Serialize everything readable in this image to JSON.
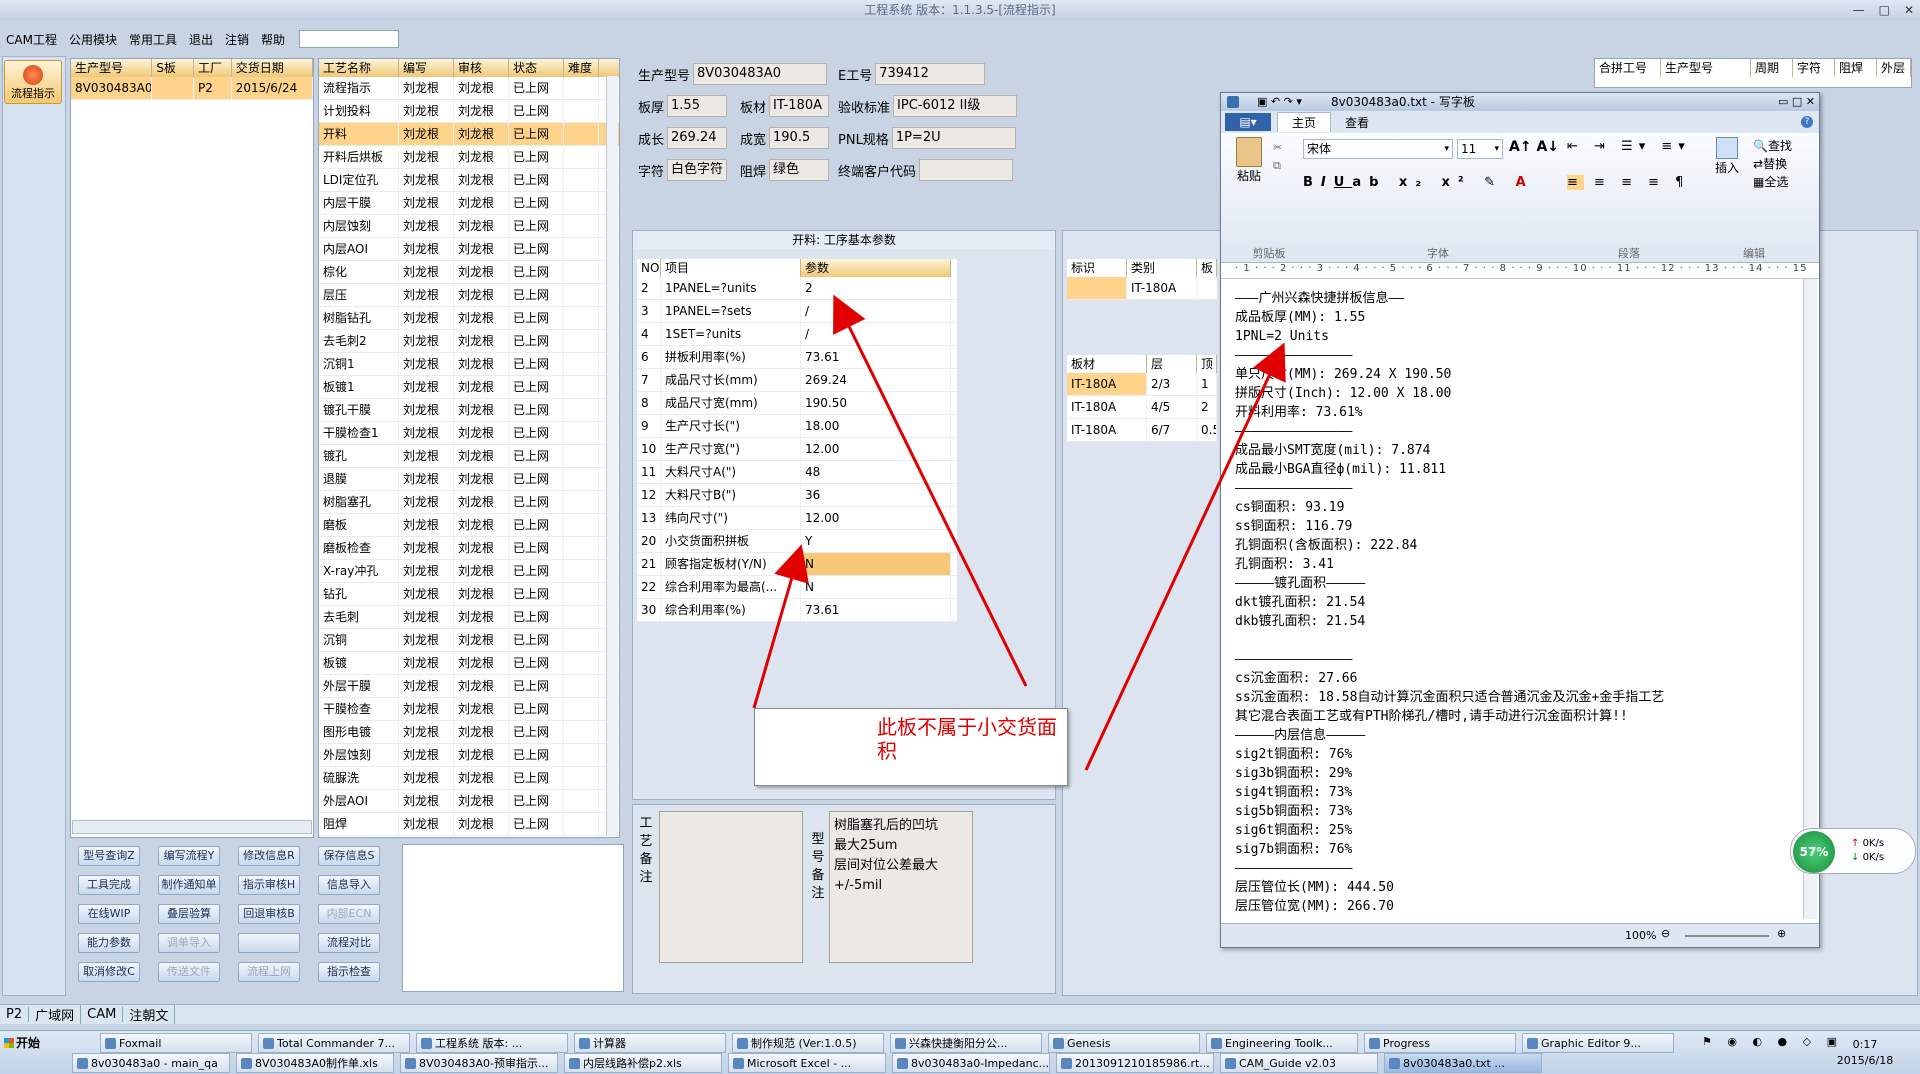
{
  "app": {
    "title": "工程系统 版本：1.1.3.5-[流程指示]",
    "controls": [
      "—",
      "□",
      "✕"
    ]
  },
  "menu": [
    "CAM工程",
    "公用模块",
    "常用工具",
    "退出",
    "注销",
    "帮助"
  ],
  "leftnav": {
    "label": "流程指示"
  },
  "orders": {
    "headers": [
      "生产型号",
      "S板",
      "工厂",
      "交货日期"
    ],
    "rows": [
      [
        "8V030483A0",
        "",
        "P2",
        "2015/6/24"
      ]
    ]
  },
  "process": {
    "headers": [
      "工艺名称",
      "编写",
      "审核",
      "状态",
      "难度"
    ],
    "rows": [
      [
        "流程指示",
        "刘龙根",
        "刘龙根",
        "已上网",
        ""
      ],
      [
        "计划投料",
        "刘龙根",
        "刘龙根",
        "已上网",
        ""
      ],
      [
        "开料",
        "刘龙根",
        "刘龙根",
        "已上网",
        ""
      ],
      [
        "开料后烘板",
        "刘龙根",
        "刘龙根",
        "已上网",
        ""
      ],
      [
        "LDI定位孔",
        "刘龙根",
        "刘龙根",
        "已上网",
        ""
      ],
      [
        "内层干膜",
        "刘龙根",
        "刘龙根",
        "已上网",
        ""
      ],
      [
        "内层蚀刻",
        "刘龙根",
        "刘龙根",
        "已上网",
        ""
      ],
      [
        "内层AOI",
        "刘龙根",
        "刘龙根",
        "已上网",
        ""
      ],
      [
        "棕化",
        "刘龙根",
        "刘龙根",
        "已上网",
        ""
      ],
      [
        "层压",
        "刘龙根",
        "刘龙根",
        "已上网",
        ""
      ],
      [
        "树脂钻孔",
        "刘龙根",
        "刘龙根",
        "已上网",
        ""
      ],
      [
        "去毛刺2",
        "刘龙根",
        "刘龙根",
        "已上网",
        ""
      ],
      [
        "沉铜1",
        "刘龙根",
        "刘龙根",
        "已上网",
        ""
      ],
      [
        "板镀1",
        "刘龙根",
        "刘龙根",
        "已上网",
        ""
      ],
      [
        "镀孔干膜",
        "刘龙根",
        "刘龙根",
        "已上网",
        ""
      ],
      [
        "干膜检查1",
        "刘龙根",
        "刘龙根",
        "已上网",
        ""
      ],
      [
        "镀孔",
        "刘龙根",
        "刘龙根",
        "已上网",
        ""
      ],
      [
        "退膜",
        "刘龙根",
        "刘龙根",
        "已上网",
        ""
      ],
      [
        "树脂塞孔",
        "刘龙根",
        "刘龙根",
        "已上网",
        ""
      ],
      [
        "磨板",
        "刘龙根",
        "刘龙根",
        "已上网",
        ""
      ],
      [
        "磨板检查",
        "刘龙根",
        "刘龙根",
        "已上网",
        ""
      ],
      [
        "X-ray冲孔",
        "刘龙根",
        "刘龙根",
        "已上网",
        ""
      ],
      [
        "钻孔",
        "刘龙根",
        "刘龙根",
        "已上网",
        ""
      ],
      [
        "去毛刺",
        "刘龙根",
        "刘龙根",
        "已上网",
        ""
      ],
      [
        "沉铜",
        "刘龙根",
        "刘龙根",
        "已上网",
        ""
      ],
      [
        "板镀",
        "刘龙根",
        "刘龙根",
        "已上网",
        ""
      ],
      [
        "外层干膜",
        "刘龙根",
        "刘龙根",
        "已上网",
        ""
      ],
      [
        "干膜检查",
        "刘龙根",
        "刘龙根",
        "已上网",
        ""
      ],
      [
        "图形电镀",
        "刘龙根",
        "刘龙根",
        "已上网",
        ""
      ],
      [
        "外层蚀刻",
        "刘龙根",
        "刘龙根",
        "已上网",
        ""
      ],
      [
        "硫脲洗",
        "刘龙根",
        "刘龙根",
        "已上网",
        ""
      ],
      [
        "外层AOI",
        "刘龙根",
        "刘龙根",
        "已上网",
        ""
      ],
      [
        "阻焊",
        "刘龙根",
        "刘龙根",
        "已上网",
        ""
      ]
    ]
  },
  "buttons": [
    [
      "型号查询Z",
      "编写流程Y",
      "修改信息R",
      "保存信息S"
    ],
    [
      "工具完成",
      "制作通知单",
      "指示审核H",
      "信息导入"
    ],
    [
      "在线WIP",
      "叠层验算",
      "回退审核B",
      "内部ECN"
    ],
    [
      "能力参数",
      "调单导入",
      "",
      "流程对比"
    ],
    [
      "取消修改C",
      "传送文件",
      "流程上网",
      "指示检查"
    ]
  ],
  "info": {
    "r1": [
      {
        "l": "生产型号",
        "v": "8V030483A0"
      },
      {
        "l": "E工号",
        "v": "739412"
      }
    ],
    "r2": [
      {
        "l": "板厚",
        "v": "1.55"
      },
      {
        "l": "板材",
        "v": "IT-180A"
      },
      {
        "l": "验收标准",
        "v": "IPC-6012 II级"
      }
    ],
    "r3": [
      {
        "l": "成长",
        "v": "269.24"
      },
      {
        "l": "成宽",
        "v": "190.5"
      },
      {
        "l": "PNL规格",
        "v": "1P=2U"
      }
    ],
    "r4": [
      {
        "l": "字符",
        "v": "白色字符"
      },
      {
        "l": "阻焊",
        "v": "绿色"
      },
      {
        "l": "终端客户代码",
        "v": ""
      }
    ]
  },
  "params": {
    "title": "开料: 工序基本参数",
    "headers": [
      "NO",
      "项目",
      "参数"
    ],
    "rows": [
      [
        "2",
        "1PANEL=?units",
        "2"
      ],
      [
        "3",
        "1PANEL=?sets",
        "/"
      ],
      [
        "4",
        "1SET=?units",
        "/"
      ],
      [
        "6",
        "拼板利用率(%)",
        "73.61"
      ],
      [
        "7",
        "成品尺寸长(mm)",
        "269.24"
      ],
      [
        "8",
        "成品尺寸宽(mm)",
        "190.50"
      ],
      [
        "9",
        "生产尺寸长(\")",
        "18.00"
      ],
      [
        "10",
        "生产尺寸宽(\")",
        "12.00"
      ],
      [
        "11",
        "大料尺寸A(\")",
        "48"
      ],
      [
        "12",
        "大料尺寸B(\")",
        "36"
      ],
      [
        "13",
        "纬向尺寸(\")",
        "12.00"
      ],
      [
        "20",
        "小交货面积拼板",
        "Y"
      ],
      [
        "21",
        "顾客指定板材(Y/N)",
        "N"
      ],
      [
        "22",
        "综合利用率为最高(...",
        "N"
      ],
      [
        "30",
        "综合利用率(%)",
        "73.61"
      ]
    ]
  },
  "remarks": {
    "left_label": "工艺备注",
    "right_label": "型号备注",
    "right_text": [
      "树脂塞孔后的凹坑",
      "最大25um",
      "层间对位公差最大",
      "+/-5mil"
    ]
  },
  "right_table": {
    "headers": [
      "合拼工号",
      "生产型号",
      "周期",
      "字符",
      "阻焊",
      "外层"
    ]
  },
  "mark_table": {
    "headers": [
      "标识",
      "类别",
      "板"
    ],
    "rows": [
      [
        "",
        "IT-180A"
      ]
    ]
  },
  "mat_table": {
    "headers": [
      "板材",
      "层",
      "顶"
    ],
    "rows": [
      [
        "IT-180A",
        "2/3",
        "1"
      ],
      [
        "IT-180A",
        "4/5",
        "2"
      ],
      [
        "IT-180A",
        "6/7",
        "0.5"
      ]
    ]
  },
  "callout": "此板不属于小交货面积",
  "wordpad": {
    "title": "8v030483a0.txt - 写字板",
    "tabs": [
      "主页",
      "查看"
    ],
    "font": "宋体",
    "size": "11",
    "groups": [
      "剪贴板",
      "字体",
      "段落",
      "编辑"
    ],
    "paste": "粘贴",
    "insert": "插入",
    "edit": [
      "查找",
      "替换",
      "全选"
    ],
    "ruler": "· 1 · · · 2 · · · 3 · · · 4 · · · 5 · · · 6 · · · 7 · · · 8 · · · 9 · · · 10 · · · 11 · · · 12 · · · 13 · · · 14 · · · 15",
    "zoom": "100%",
    "lines": [
      "———广州兴森快捷拼板信息——",
      "成品板厚(MM): 1.55",
      "1PNL=2 Units",
      "———————————————",
      "单只尺寸(MM): 269.24 X 190.50",
      "拼版尺寸(Inch): 12.00 X 18.00",
      "开料利用率: 73.61%",
      "———————————————",
      "成品最小SMT宽度(mil): 7.874",
      "成品最小BGA直径ф(mil): 11.811",
      "———————————————",
      "cs铜面积: 93.19",
      "ss铜面积: 116.79",
      "孔铜面积(含板面积): 222.84",
      "孔铜面积: 3.41",
      "—————镀孔面积—————",
      "dkt镀孔面积: 21.54",
      "dkb镀孔面积: 21.54",
      "",
      "———————————————",
      "cs沉金面积: 27.66",
      "ss沉金面积: 18.58自动计算沉金面积只适合普通沉金及沉金+金手指工艺",
      "其它混合表面工艺或有PTH阶梯孔/槽时,请手动进行沉金面积计算!!",
      "—————内层信息—————",
      "sig2t铜面积: 76%",
      "sig3b铜面积: 29%",
      "sig4t铜面积: 73%",
      "sig5b铜面积: 73%",
      "sig6t铜面积: 25%",
      "sig7b铜面积: 76%",
      "———————————————",
      "层压管位长(MM): 444.50",
      "层压管位宽(MM): 266.70"
    ]
  },
  "net": {
    "pct": "57%",
    "up": "0K/s",
    "down": "0K/s"
  },
  "statusbar": [
    "P2",
    "广域网",
    "CAM",
    "注朝文"
  ],
  "taskbar": {
    "start": "开始",
    "row1": [
      "Foxmail",
      "Total Commander 7...",
      "工程系统 版本: ...",
      "计算器",
      "制作规范 (Ver:1.0.5)",
      "兴森快捷衡阳分公...",
      "Genesis",
      "Engineering Toolk...",
      "Progress",
      "Graphic Editor 9..."
    ],
    "row2": [
      "8v030483a0 - main_qa",
      "8V030483A0制作单.xls",
      "8V030483A0-预审指示...",
      "内层线路补偿p2.xls",
      "Microsoft Excel - ...",
      "8v030483a0-Impedanc...",
      "2013091210185986.rt...",
      "CAM_Guide v2.03",
      "8v030483a0.txt ..."
    ],
    "time": "0:17",
    "date": "2015/6/18"
  },
  "colors": {
    "accent": "#f0c878",
    "selected": "#ffd48a",
    "arrow": "#e00000",
    "callout_text": "#e00000"
  }
}
